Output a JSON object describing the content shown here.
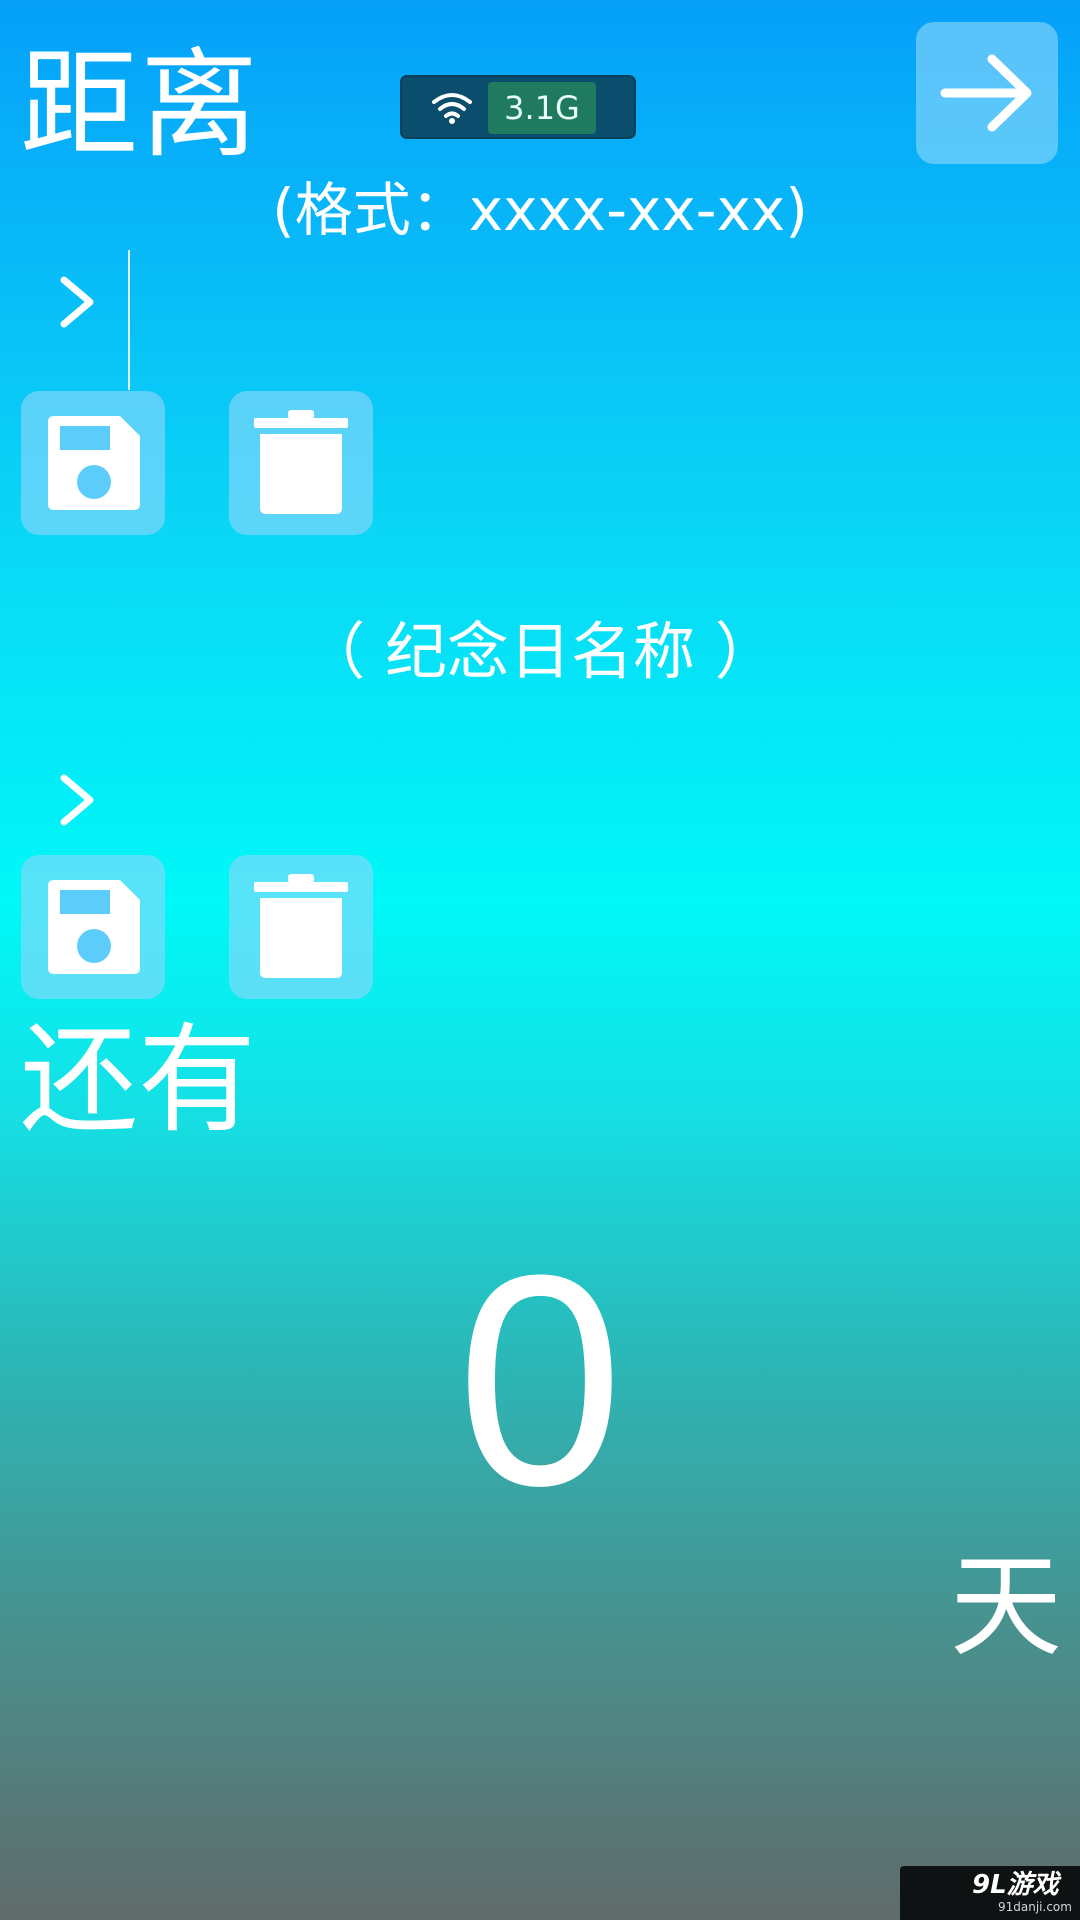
{
  "header": {
    "title": "距离",
    "next_icon": "arrow-right-icon"
  },
  "status": {
    "wifi_icon": "wifi-icon",
    "net_speed": "3.1G"
  },
  "date_section": {
    "format_hint": "(格式：xxxx-xx-xx)",
    "expand_icon": "chevron-right-icon",
    "save_icon": "floppy-disk-icon",
    "delete_icon": "trash-icon"
  },
  "name_section": {
    "hint": "（ 纪念日名称 ）",
    "expand_icon": "chevron-right-icon",
    "save_icon": "floppy-disk-icon",
    "delete_icon": "trash-icon"
  },
  "result": {
    "label": "还有",
    "count": "0",
    "unit": "天"
  },
  "watermark": {
    "brand": "9L游戏",
    "url": "91danji.com"
  },
  "colors": {
    "button_bg": "#8ed7fa",
    "icon_fill": "#ffffff",
    "save_dot": "#5ccdfa",
    "status_bg": "#0b4d6c",
    "speed_bg": "#1f7a5f"
  }
}
